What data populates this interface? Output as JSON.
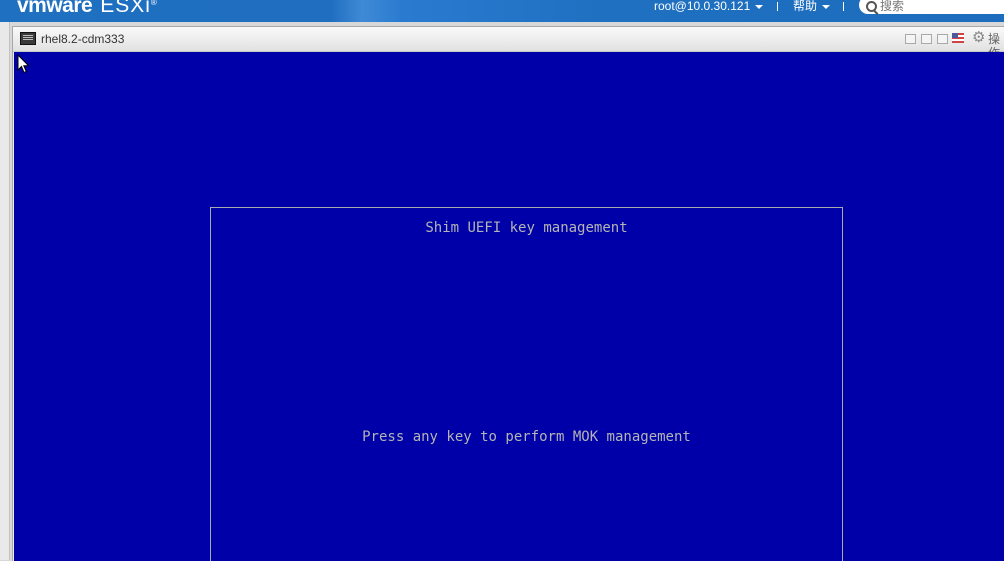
{
  "header": {
    "logo_vm": "vmware",
    "logo_esxi": "ESXi",
    "logo_reg": "®",
    "user": "root@10.0.30.121",
    "help": "帮助",
    "search_placeholder": "搜索"
  },
  "window": {
    "title": "rhel8.2-cdm333",
    "actions_label": "操作"
  },
  "console": {
    "background_color": "#0000a8",
    "text_color": "#b4b4b4",
    "box_title": "Shim UEFI key management",
    "message": "Press any key to perform MOK management"
  },
  "icons": [
    "search-icon",
    "console-icon",
    "gear-icon",
    "flag-icon",
    "mouse-cursor-icon"
  ]
}
